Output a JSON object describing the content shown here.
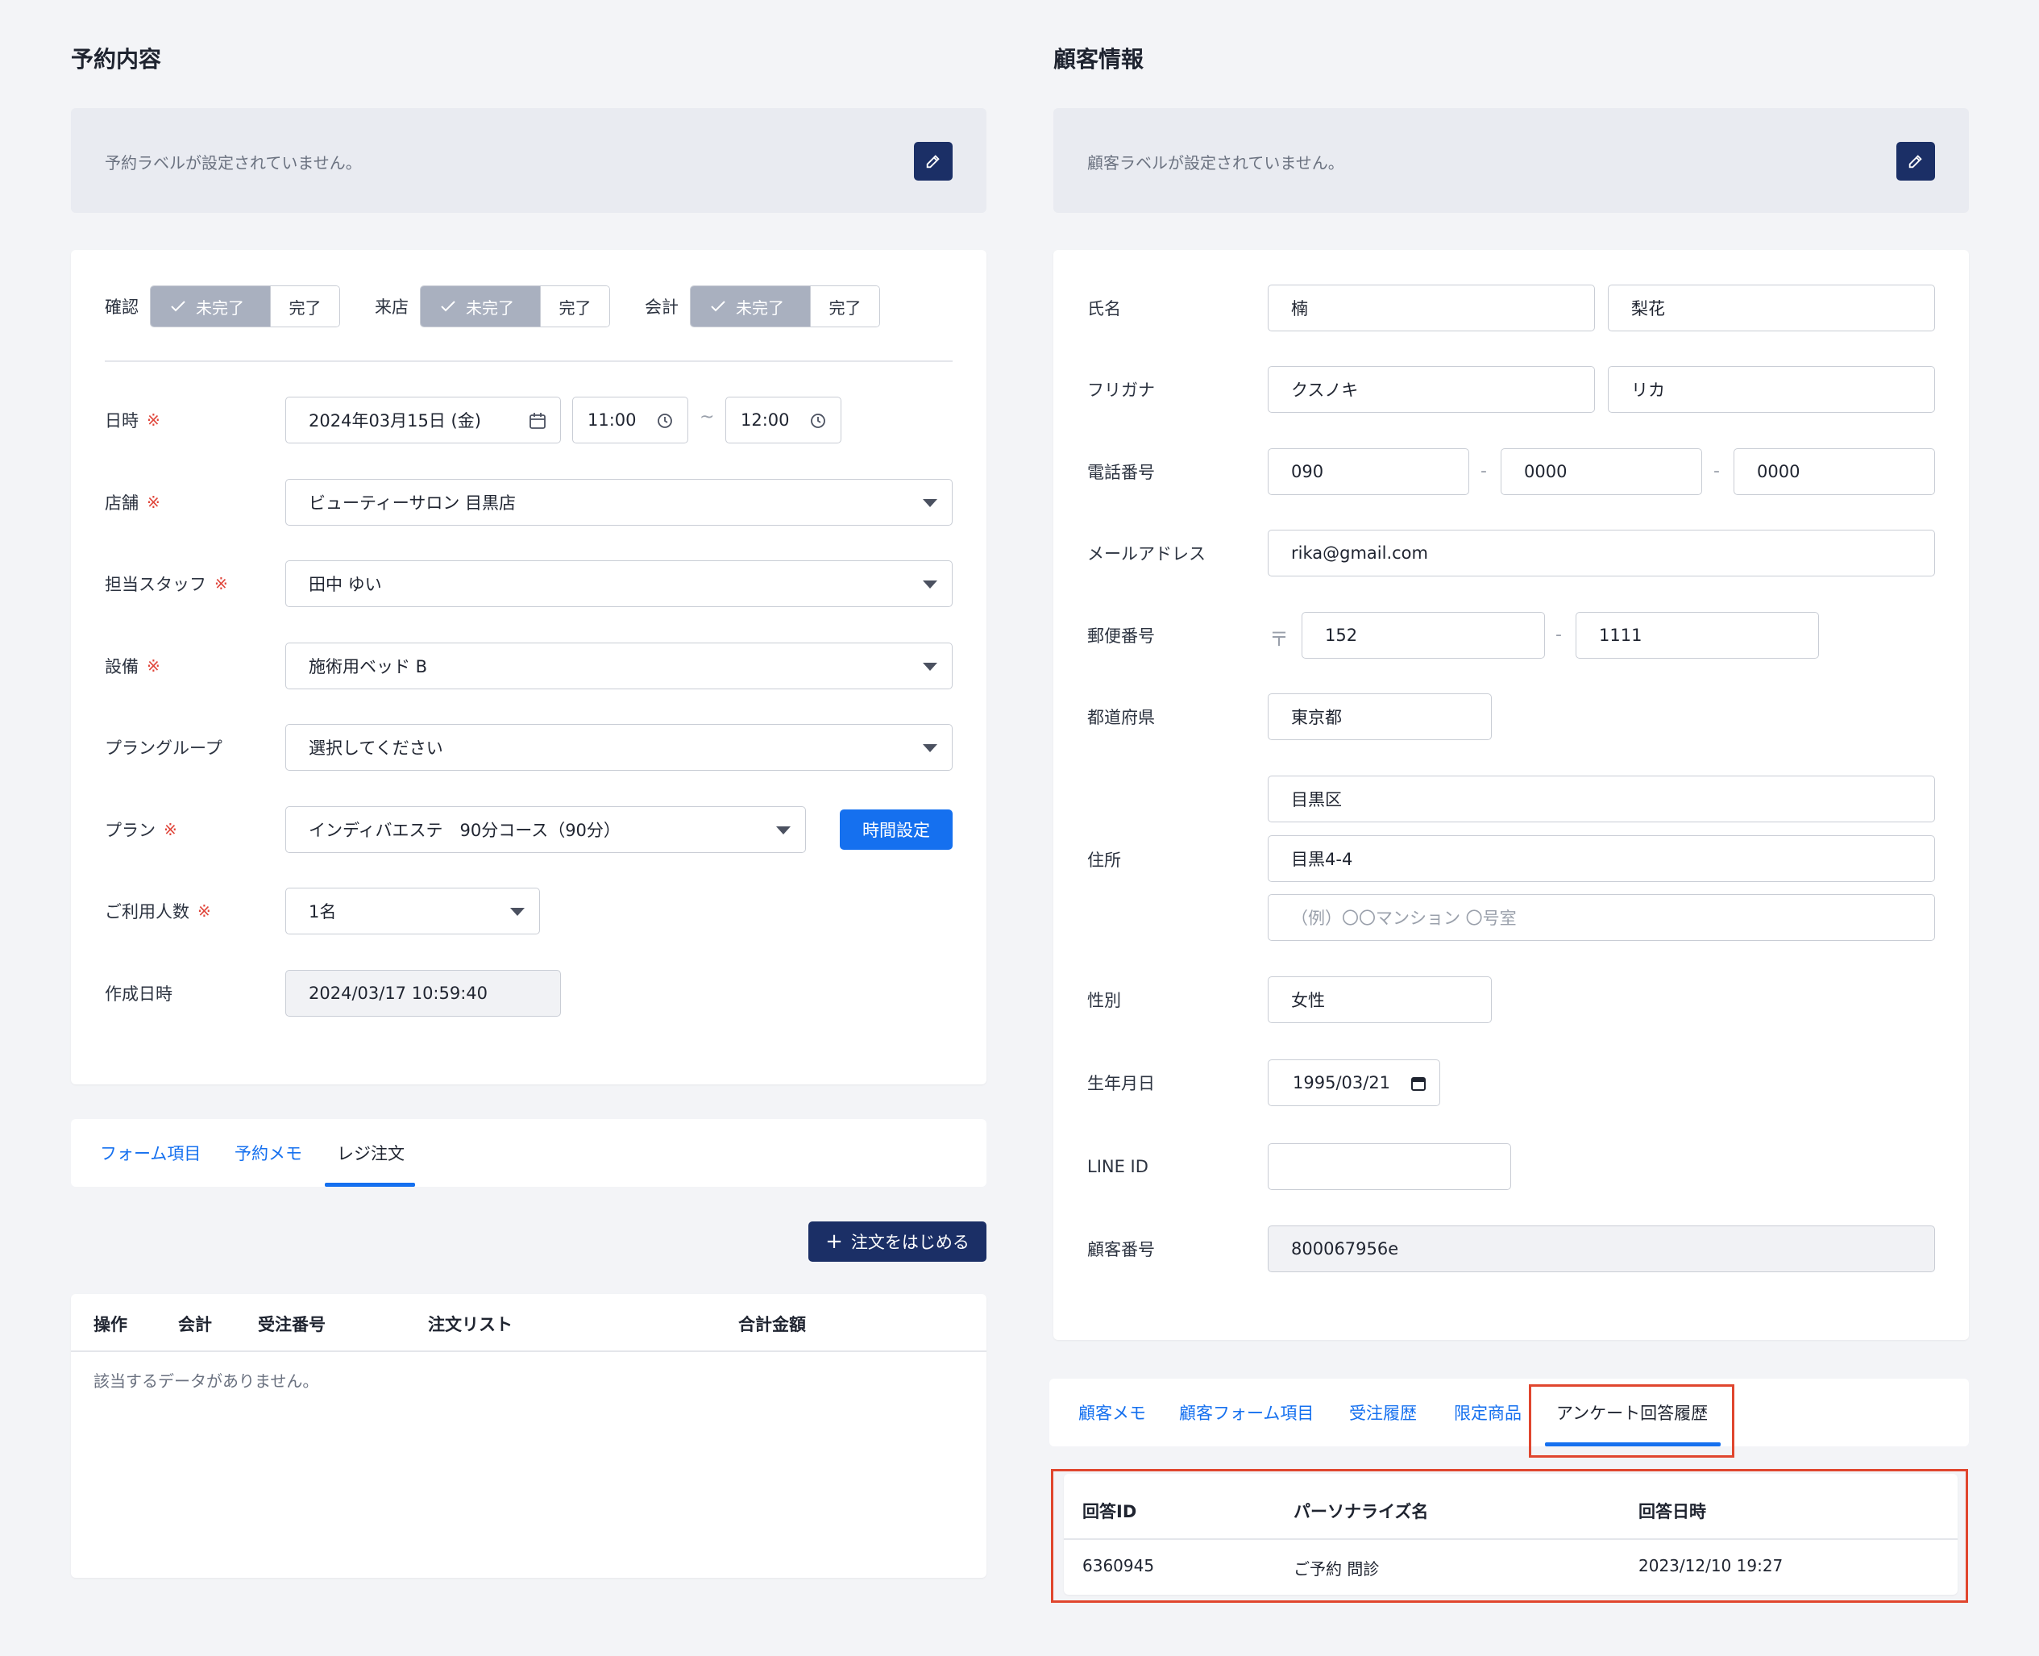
{
  "left": {
    "title": "予約内容",
    "label_bar_text": "予約ラベルが設定されていません。",
    "status": [
      {
        "label": "確認",
        "on": "未完了",
        "off": "完了"
      },
      {
        "label": "来店",
        "on": "未完了",
        "off": "完了"
      },
      {
        "label": "会計",
        "on": "未完了",
        "off": "完了"
      }
    ],
    "required_mark": "※",
    "fields": {
      "datetime_label": "日時",
      "date_value": "2024年03月15日 (金)",
      "time_start": "11:00",
      "time_sep": "~",
      "time_end": "12:00",
      "store_label": "店舗",
      "store_value": "ビューティーサロン 目黒店",
      "staff_label": "担当スタッフ",
      "staff_value": "田中 ゆい",
      "equipment_label": "設備",
      "equipment_value": "施術用ベッド B",
      "plan_group_label": "プラングループ",
      "plan_group_value": "選択してください",
      "plan_label": "プラン",
      "plan_value": "インディバエステ　90分コース（90分）",
      "time_setting_button": "時間設定",
      "people_label": "ご利用人数",
      "people_value": "1名",
      "created_label": "作成日時",
      "created_value": "2024/03/17 10:59:40"
    },
    "tabs": [
      "フォーム項目",
      "予約メモ",
      "レジ注文"
    ],
    "start_order_button": "注文をはじめる",
    "order_table": {
      "headers": [
        "操作",
        "会計",
        "受注番号",
        "注文リスト",
        "合計金額"
      ],
      "empty_text": "該当するデータがありません。"
    }
  },
  "right": {
    "title": "顧客情報",
    "label_bar_text": "顧客ラベルが設定されていません。",
    "fields": {
      "name_label": "氏名",
      "last_name": "楠",
      "first_name": "梨花",
      "kana_label": "フリガナ",
      "last_kana": "クスノキ",
      "first_kana": "リカ",
      "phone_label": "電話番号",
      "phone_1": "090",
      "phone_2": "0000",
      "phone_3": "0000",
      "phone_sep": "-",
      "email_label": "メールアドレス",
      "email_value": "rika@gmail.com",
      "postal_label": "郵便番号",
      "postal_mark": "〒",
      "postal_1": "152",
      "postal_2": "1111",
      "prefecture_label": "都道府県",
      "prefecture_value": "東京都",
      "address_label": "住所",
      "address_1": "目黒区",
      "address_2": "目黒4-4",
      "address_3_placeholder": "（例）〇〇マンション 〇号室",
      "gender_label": "性別",
      "gender_value": "女性",
      "birthday_label": "生年月日",
      "birthday_value": "1995/03/21",
      "line_label": "LINE ID",
      "line_value": "",
      "customer_no_label": "顧客番号",
      "customer_no_value": "800067956e"
    },
    "tabs": [
      "顧客メモ",
      "顧客フォーム項目",
      "受注履歴",
      "限定商品",
      "アンケート回答履歴"
    ],
    "survey_table": {
      "headers": [
        "回答ID",
        "パーソナライズ名",
        "回答日時"
      ],
      "rows": [
        [
          "6360945",
          "ご予約  問診",
          "2023/12/10 19:27"
        ]
      ]
    }
  },
  "colors": {
    "navy": "#1b2f66",
    "blue": "#1570ef",
    "required": "#e0463b",
    "highlight": "#e0462e"
  }
}
